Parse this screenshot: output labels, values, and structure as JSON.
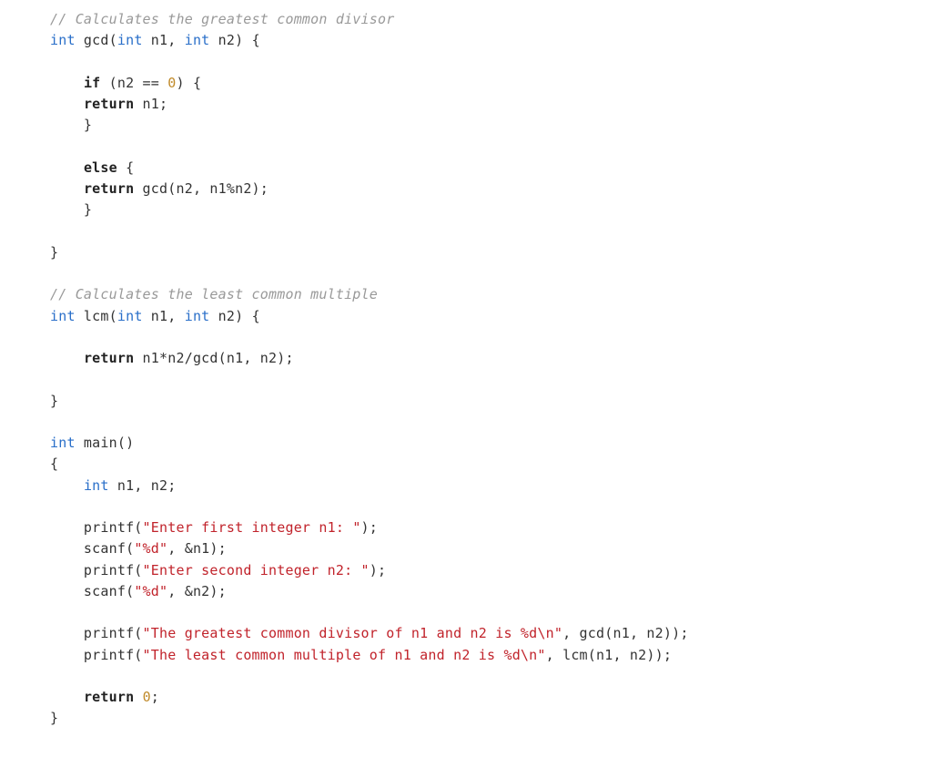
{
  "code": {
    "lines": [
      [
        {
          "cls": "tok-comment",
          "t": "// Calculates the greatest common divisor"
        }
      ],
      [
        {
          "cls": "tok-type",
          "t": "int"
        },
        {
          "cls": "tok-default",
          "t": " gcd("
        },
        {
          "cls": "tok-type",
          "t": "int"
        },
        {
          "cls": "tok-default",
          "t": " n1, "
        },
        {
          "cls": "tok-type",
          "t": "int"
        },
        {
          "cls": "tok-default",
          "t": " n2) {"
        }
      ],
      [],
      [
        {
          "cls": "tok-default",
          "t": "    "
        },
        {
          "cls": "tok-keyword",
          "t": "if"
        },
        {
          "cls": "tok-default",
          "t": " (n2 == "
        },
        {
          "cls": "tok-number",
          "t": "0"
        },
        {
          "cls": "tok-default",
          "t": ") {"
        }
      ],
      [
        {
          "cls": "tok-default",
          "t": "    "
        },
        {
          "cls": "tok-keyword",
          "t": "return"
        },
        {
          "cls": "tok-default",
          "t": " n1;"
        }
      ],
      [
        {
          "cls": "tok-default",
          "t": "    }"
        }
      ],
      [],
      [
        {
          "cls": "tok-default",
          "t": "    "
        },
        {
          "cls": "tok-keyword",
          "t": "else"
        },
        {
          "cls": "tok-default",
          "t": " {"
        }
      ],
      [
        {
          "cls": "tok-default",
          "t": "    "
        },
        {
          "cls": "tok-keyword",
          "t": "return"
        },
        {
          "cls": "tok-default",
          "t": " gcd(n2, n1%n2);"
        }
      ],
      [
        {
          "cls": "tok-default",
          "t": "    }"
        }
      ],
      [],
      [
        {
          "cls": "tok-default",
          "t": "}"
        }
      ],
      [],
      [
        {
          "cls": "tok-comment",
          "t": "// Calculates the least common multiple"
        }
      ],
      [
        {
          "cls": "tok-type",
          "t": "int"
        },
        {
          "cls": "tok-default",
          "t": " lcm("
        },
        {
          "cls": "tok-type",
          "t": "int"
        },
        {
          "cls": "tok-default",
          "t": " n1, "
        },
        {
          "cls": "tok-type",
          "t": "int"
        },
        {
          "cls": "tok-default",
          "t": " n2) {"
        }
      ],
      [],
      [
        {
          "cls": "tok-default",
          "t": "    "
        },
        {
          "cls": "tok-keyword",
          "t": "return"
        },
        {
          "cls": "tok-default",
          "t": " n1*n2/gcd(n1, n2);"
        }
      ],
      [],
      [
        {
          "cls": "tok-default",
          "t": "}"
        }
      ],
      [],
      [
        {
          "cls": "tok-type",
          "t": "int"
        },
        {
          "cls": "tok-default",
          "t": " main()"
        }
      ],
      [
        {
          "cls": "tok-default",
          "t": "{"
        }
      ],
      [
        {
          "cls": "tok-default",
          "t": "    "
        },
        {
          "cls": "tok-type",
          "t": "int"
        },
        {
          "cls": "tok-default",
          "t": " n1, n2;"
        }
      ],
      [],
      [
        {
          "cls": "tok-default",
          "t": "    printf("
        },
        {
          "cls": "tok-string",
          "t": "\"Enter first integer n1: \""
        },
        {
          "cls": "tok-default",
          "t": ");"
        }
      ],
      [
        {
          "cls": "tok-default",
          "t": "    scanf("
        },
        {
          "cls": "tok-string",
          "t": "\"%d\""
        },
        {
          "cls": "tok-default",
          "t": ", &n1);"
        }
      ],
      [
        {
          "cls": "tok-default",
          "t": "    printf("
        },
        {
          "cls": "tok-string",
          "t": "\"Enter second integer n2: \""
        },
        {
          "cls": "tok-default",
          "t": ");"
        }
      ],
      [
        {
          "cls": "tok-default",
          "t": "    scanf("
        },
        {
          "cls": "tok-string",
          "t": "\"%d\""
        },
        {
          "cls": "tok-default",
          "t": ", &n2);"
        }
      ],
      [],
      [
        {
          "cls": "tok-default",
          "t": "    printf("
        },
        {
          "cls": "tok-string",
          "t": "\"The greatest common divisor of n1 and n2 is %d\\n\""
        },
        {
          "cls": "tok-default",
          "t": ", gcd(n1, n2));"
        }
      ],
      [
        {
          "cls": "tok-default",
          "t": "    printf("
        },
        {
          "cls": "tok-string",
          "t": "\"The least common multiple of n1 and n2 is %d\\n\""
        },
        {
          "cls": "tok-default",
          "t": ", lcm(n1, n2));"
        }
      ],
      [],
      [
        {
          "cls": "tok-default",
          "t": "    "
        },
        {
          "cls": "tok-keyword",
          "t": "return"
        },
        {
          "cls": "tok-default",
          "t": " "
        },
        {
          "cls": "tok-number",
          "t": "0"
        },
        {
          "cls": "tok-default",
          "t": ";"
        }
      ],
      [
        {
          "cls": "tok-default",
          "t": "}"
        }
      ]
    ]
  }
}
